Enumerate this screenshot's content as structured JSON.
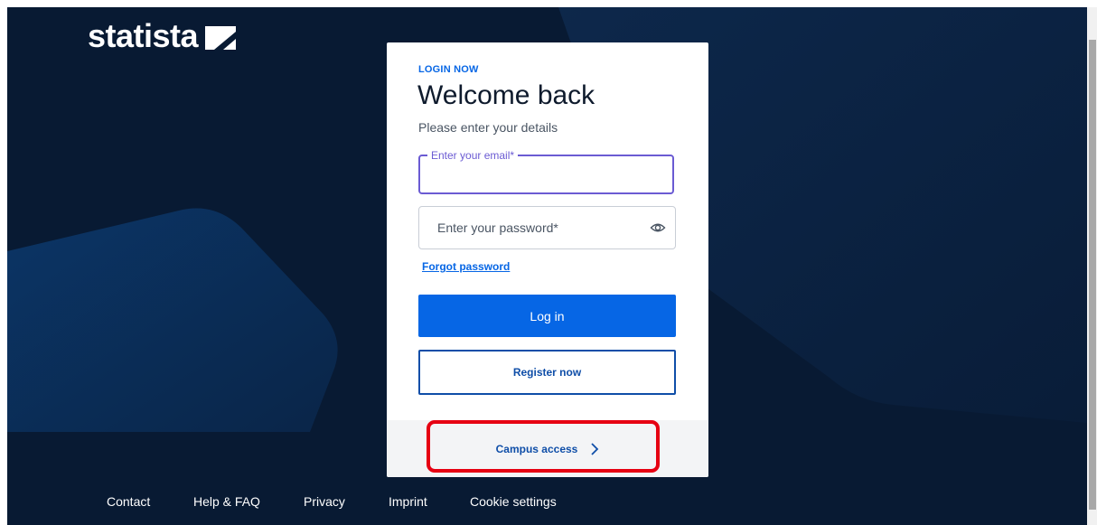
{
  "brand": {
    "name": "statista"
  },
  "login": {
    "eyebrow": "LOGIN NOW",
    "title": "Welcome back",
    "subtitle": "Please enter your details",
    "email_label": "Enter your email*",
    "email_value": "",
    "password_placeholder": "Enter your password*",
    "forgot_label": "Forgot password",
    "login_label": "Log in",
    "register_label": "Register now",
    "campus_label": "Campus access"
  },
  "footer": {
    "links": [
      "Contact",
      "Help & FAQ",
      "Privacy",
      "Imprint",
      "Cookie settings"
    ]
  },
  "icons": {
    "password_toggle": "eye-icon",
    "campus_arrow": "chevron-right-icon",
    "brand_mark": "statista-logo-mark"
  },
  "colors": {
    "background": "#081a33",
    "primary": "#0666e5",
    "focus": "#6b5bd3",
    "highlight": "#e60012"
  }
}
